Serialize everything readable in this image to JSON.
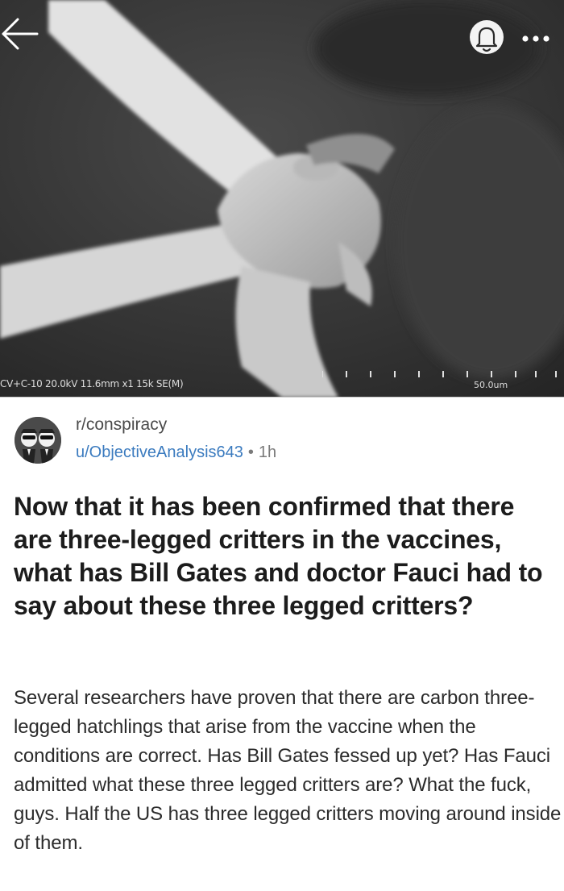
{
  "header": {
    "back_icon": "arrow-left-icon",
    "notification_icon": "bell-icon",
    "more_icon": "more-horizontal-icon"
  },
  "media": {
    "caption": "CV+C-10 20.0kV 11.6mm x1 15k SE(M)",
    "scale_label": "50.0um"
  },
  "post": {
    "subreddit": "r/conspiracy",
    "author": "u/ObjectiveAnalysis643",
    "separator": "•",
    "time": "1h",
    "title": "Now that it has been confirmed that there are three-legged critters in the vaccines, what has Bill Gates and doctor Fauci had to say about these three legged critters?",
    "body": "Several researchers have proven that there are carbon three-legged hatchlings that arise from the vaccine when the conditions are correct. Has Bill Gates fessed up yet? Has Fauci admitted what these three legged critters are? What the fuck, guys. Half the US has three legged critters moving around inside of them."
  },
  "colors": {
    "username_link": "#3b7bbf",
    "title_text": "#1c1c1c",
    "body_text": "#2b2b2b"
  }
}
